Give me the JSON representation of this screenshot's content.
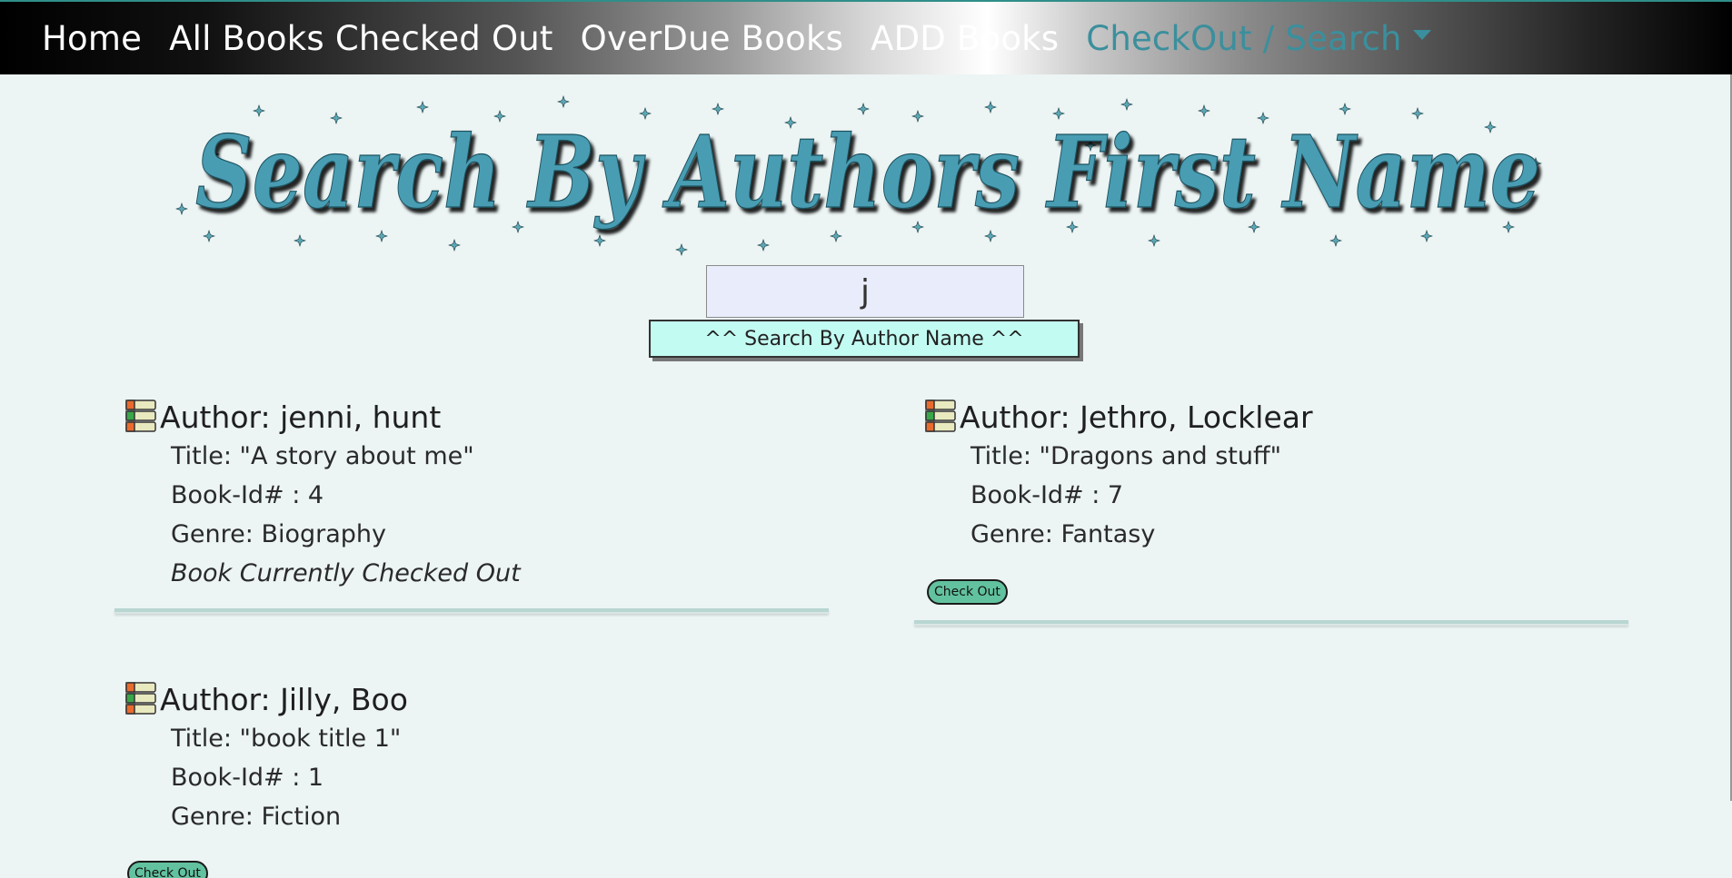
{
  "nav": {
    "items": [
      {
        "label": "Home"
      },
      {
        "label": "All Books Checked Out"
      },
      {
        "label": "OverDue Books"
      },
      {
        "label": "ADD Books"
      },
      {
        "label": "CheckOut / Search"
      }
    ]
  },
  "banner": {
    "title": "Search By Authors First Name"
  },
  "search": {
    "value": "j",
    "button_label": "^^ Search By Author Name ^^"
  },
  "results": [
    {
      "author": "Author: jenni, hunt",
      "title": "Title: \"A story about me\"",
      "book_id": "Book-Id# : 4",
      "genre": "Genre: Biography",
      "status": "Book Currently Checked Out"
    },
    {
      "author": "Author: Jethro, Locklear",
      "title": "Title: \"Dragons and stuff\"",
      "book_id": "Book-Id# : 7",
      "genre": "Genre: Fantasy",
      "button_label": "Check Out"
    },
    {
      "author": "Author: Jilly, Boo",
      "title": "Title: \"book title 1\"",
      "book_id": "Book-Id# : 1",
      "genre": "Genre: Fiction",
      "button_label": "Check Out"
    }
  ],
  "icons": {
    "book": "stack-of-books-icon",
    "dropdown": "caret-down-icon"
  },
  "colors": {
    "accent": "#3b8f9d",
    "background": "#ecf4f4",
    "search_button": "#c2fbf2",
    "checkout_button": "#62c2a0"
  }
}
